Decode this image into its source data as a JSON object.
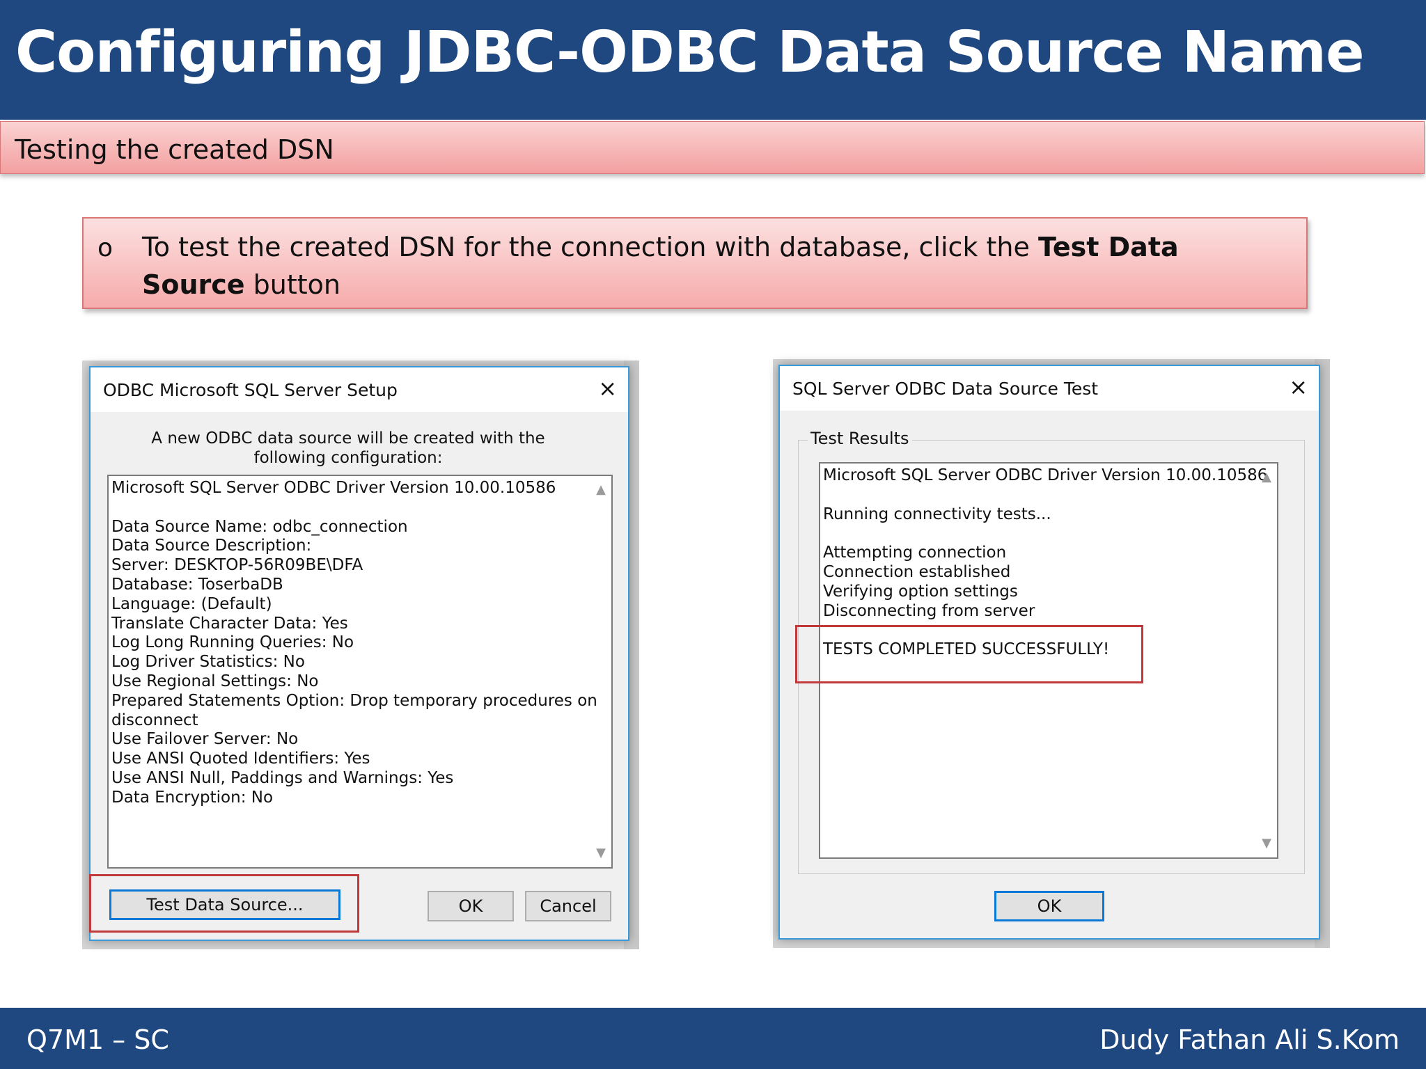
{
  "slide": {
    "title": "Configuring JDBC-ODBC Data Source Name",
    "subtitle": "Testing the created DSN",
    "bullet_symbol": "o",
    "note_pre": "To test the created DSN for the connection with database, click the ",
    "note_bold": "Test Data Source",
    "note_post": " button"
  },
  "setup_dialog": {
    "title": "ODBC Microsoft SQL Server Setup",
    "close_icon": "×",
    "intro": "A new ODBC data source will be created with the following configuration:",
    "config_lines": [
      "Microsoft SQL Server ODBC Driver Version 10.00.10586",
      "",
      "Data Source Name: odbc_connection",
      "Data Source Description:",
      "Server: DESKTOP-56R09BE\\DFA",
      "Database: ToserbaDB",
      "Language: (Default)",
      "Translate Character Data: Yes",
      "Log Long Running Queries: No",
      "Log Driver Statistics: No",
      "Use Regional Settings: No",
      "Prepared Statements Option: Drop temporary procedures on",
      "disconnect",
      "Use Failover Server: No",
      "Use ANSI Quoted Identifiers: Yes",
      "Use ANSI Null, Paddings and Warnings: Yes",
      "Data Encryption: No"
    ],
    "test_button": "Test Data Source...",
    "ok_button": "OK",
    "cancel_button": "Cancel"
  },
  "test_dialog": {
    "title": "SQL Server ODBC Data Source Test",
    "close_icon": "×",
    "group_label": "Test Results",
    "result_lines": [
      "Microsoft SQL Server ODBC Driver Version 10.00.10586",
      "",
      "Running connectivity tests...",
      "",
      "Attempting connection",
      "Connection established",
      "Verifying option settings",
      "Disconnecting from server",
      "",
      "TESTS COMPLETED SUCCESSFULLY!"
    ],
    "ok_button": "OK"
  },
  "footer": {
    "left": "Q7M1 – SC",
    "right": "Dudy Fathan Ali S.Kom"
  }
}
